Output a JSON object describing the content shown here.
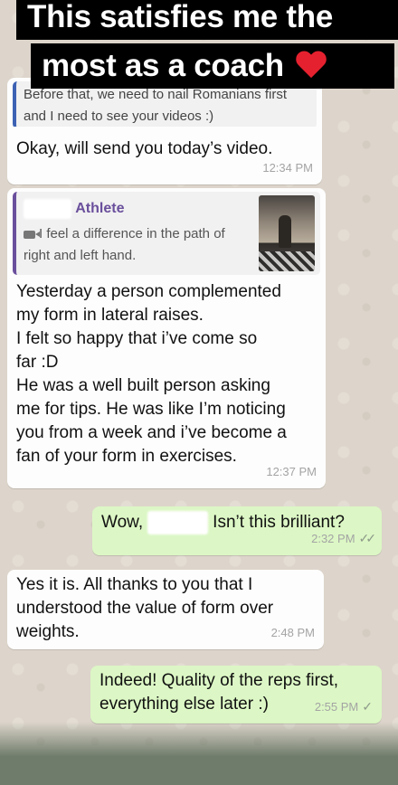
{
  "caption": {
    "line1": "This satisfies me the",
    "line2": "most as a coach"
  },
  "messages": {
    "m0_text_line1": "Before that, we need to nail Romanians first",
    "m0_text_line2": "and I need to see your videos :)",
    "m1_text": "Okay, will send you today’s video.",
    "m1_time": "12:34 PM",
    "m2_quote_sender_suffix": "Athlete",
    "m2_quote_line1": "I feel a difference in the path of",
    "m2_quote_line2": "right and left hand.",
    "m2_lines": [
      "Yesterday a person complemented",
      "my form in lateral raises.",
      "I felt so happy that i’ve come so",
      "far :D",
      "He was a well built person asking",
      "me for tips. He was like I’m noticing",
      "you from a week and i’ve become a",
      "fan of your form in exercises."
    ],
    "m2_time": "12:37 PM",
    "m3_prefix": "Wow, ",
    "m3_suffix": " Isn’t this brilliant?",
    "m3_time": "2:32 PM",
    "m4_lines": [
      "Yes it is. All thanks to you that I",
      "understood the value of form over",
      "weights."
    ],
    "m4_time": "2:48 PM",
    "m5_lines": [
      "Indeed! Quality of the reps first,",
      "everything else later :)"
    ],
    "m5_time": "2:55 PM"
  },
  "icons": {
    "double_tick": "✓✓",
    "single_tick": "✓",
    "heart": "heart-icon",
    "camera": "video-camera-icon"
  },
  "colors": {
    "incoming_bubble": "#fdfdfd",
    "outgoing_bubble": "#dcf7c5",
    "quote_accent": "#6a4f9c",
    "heart": "#e6212f"
  }
}
